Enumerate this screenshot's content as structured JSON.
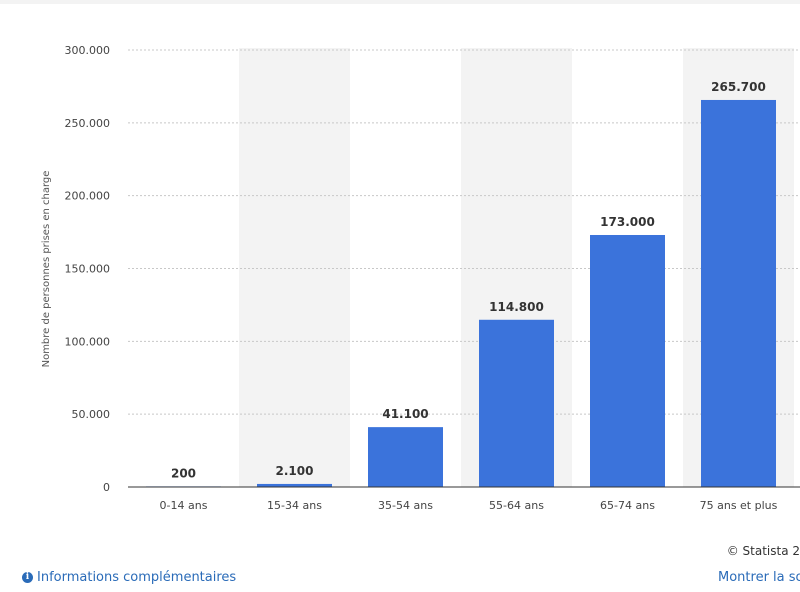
{
  "chart_data": {
    "type": "bar",
    "categories": [
      "0-14 ans",
      "15-34 ans",
      "35-54 ans",
      "55-64 ans",
      "65-74 ans",
      "75 ans et plus"
    ],
    "values": [
      200,
      2100,
      41100,
      114800,
      173000,
      265700
    ],
    "value_labels": [
      "200",
      "2.100",
      "41.100",
      "114.800",
      "173.000",
      "265.700"
    ],
    "ylabel": "Nombre de personnes prises en charge",
    "xlabel": "",
    "title": "",
    "ylim": [
      0,
      300000
    ],
    "yticks": [
      0,
      50000,
      100000,
      150000,
      200000,
      250000,
      300000
    ],
    "ytick_labels": [
      "0",
      "50.000",
      "100.000",
      "150.000",
      "200.000",
      "250.000",
      "300.000"
    ],
    "grid": true,
    "bar_color": "#3b73db",
    "band_color": "#f3f3f3"
  },
  "footer": {
    "copyright": "© Statista 2",
    "info_icon": "info-icon",
    "info_label": "Informations complémentaires",
    "source_label": "Montrer la so"
  }
}
